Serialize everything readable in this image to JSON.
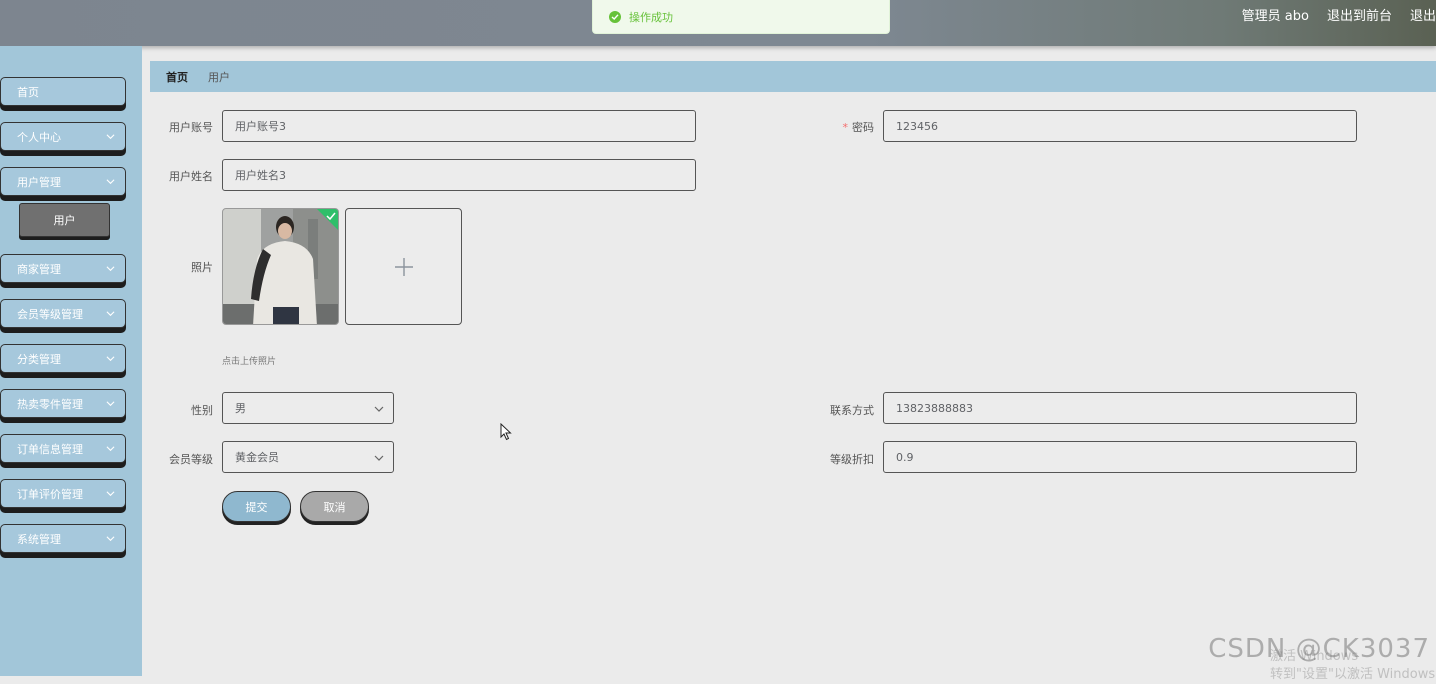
{
  "header": {
    "user_label": "管理员 abo",
    "back_to_front": "退出到前台",
    "logout": "退出"
  },
  "toast": {
    "message": "操作成功"
  },
  "sidebar": {
    "items": [
      {
        "label": "首页",
        "has_chevron": false
      },
      {
        "label": "个人中心",
        "has_chevron": true
      },
      {
        "label": "用户管理",
        "has_chevron": true,
        "expanded": true
      },
      {
        "label": "商家管理",
        "has_chevron": true
      },
      {
        "label": "会员等级管理",
        "has_chevron": true
      },
      {
        "label": "分类管理",
        "has_chevron": true
      },
      {
        "label": "热卖零件管理",
        "has_chevron": true
      },
      {
        "label": "订单信息管理",
        "has_chevron": true
      },
      {
        "label": "订单评价管理",
        "has_chevron": true
      },
      {
        "label": "系统管理",
        "has_chevron": true
      }
    ],
    "active_subitem": "用户"
  },
  "breadcrumb": {
    "home": "首页",
    "current": "用户"
  },
  "form": {
    "account": {
      "label": "用户账号",
      "value": "用户账号3"
    },
    "password": {
      "label": "密码",
      "required_mark": "*",
      "value": "123456"
    },
    "name": {
      "label": "用户姓名",
      "value": "用户姓名3"
    },
    "photo": {
      "label": "照片",
      "tip": "点击上传照片"
    },
    "gender": {
      "label": "性别",
      "value": "男"
    },
    "contact": {
      "label": "联系方式",
      "value": "13823888883"
    },
    "member_level": {
      "label": "会员等级",
      "value": "黄金会员"
    },
    "discount": {
      "label": "等级折扣",
      "value": "0.9"
    },
    "submit": "提交",
    "cancel": "取消"
  },
  "overlays": {
    "watermark": "CSDN @CK3037",
    "windows_activate_line1": "激活 Windows",
    "windows_activate_line2": "转到\"设置\"以激活 Windows"
  },
  "colors": {
    "sidebar_bg": "#a2c6d9",
    "submit_bg": "#8fb8cf",
    "cancel_bg": "#a9a9a9",
    "success": "#67c23a"
  }
}
